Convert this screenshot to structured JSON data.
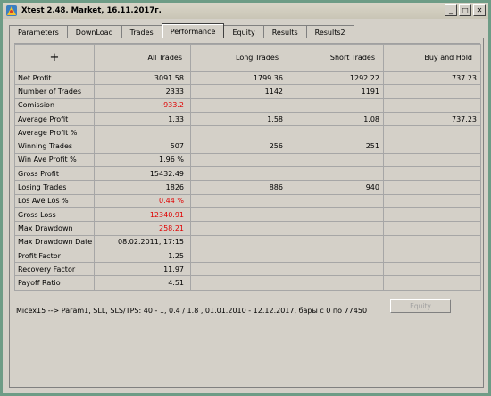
{
  "window": {
    "title": "Xtest 2.48. Market, 16.11.2017г.",
    "buttons": {
      "minimize": "_",
      "maximize": "□",
      "close": "✕"
    }
  },
  "tabs": [
    "Parameters",
    "DownLoad",
    "Trades",
    "Performance",
    "Equity",
    "Results",
    "Results2"
  ],
  "active_tab": "Performance",
  "table": {
    "corner": "+",
    "columns": [
      "All Trades",
      "Long Trades",
      "Short Trades",
      "Buy and Hold"
    ],
    "rows": [
      {
        "label": "Net Profit",
        "cells": [
          "3091.58",
          "1799.36",
          "1292.22",
          "737.23"
        ],
        "red": false
      },
      {
        "label": "Number of Trades",
        "cells": [
          "2333",
          "1142",
          "1191",
          ""
        ],
        "red": false
      },
      {
        "label": "Comission",
        "cells": [
          "-933.2",
          "",
          "",
          ""
        ],
        "red": true
      },
      {
        "label": "Average Profit",
        "cells": [
          "1.33",
          "1.58",
          "1.08",
          "737.23"
        ],
        "red": false
      },
      {
        "label": "Average Profit %",
        "cells": [
          "",
          "",
          "",
          ""
        ],
        "red": false
      },
      {
        "label": "Winning Trades",
        "cells": [
          "507",
          "256",
          "251",
          ""
        ],
        "red": false
      },
      {
        "label": "Win Ave Profit %",
        "cells": [
          "1.96 %",
          "",
          "",
          ""
        ],
        "red": false
      },
      {
        "label": "Gross Profit",
        "cells": [
          "15432.49",
          "",
          "",
          ""
        ],
        "red": false
      },
      {
        "label": "Losing Trades",
        "cells": [
          "1826",
          "886",
          "940",
          ""
        ],
        "red": false
      },
      {
        "label": "Los Ave Los %",
        "cells": [
          "0.44 %",
          "",
          "",
          ""
        ],
        "red": true
      },
      {
        "label": "Gross Loss",
        "cells": [
          "12340.91",
          "",
          "",
          ""
        ],
        "red": true
      },
      {
        "label": "Max Drawdown",
        "cells": [
          "258.21",
          "",
          "",
          ""
        ],
        "red": true
      },
      {
        "label": "Max Drawdown Date",
        "cells": [
          "08.02.2011, 17:15",
          "",
          "",
          ""
        ],
        "red": false
      },
      {
        "label": "Profit Factor",
        "cells": [
          "1.25",
          "",
          "",
          ""
        ],
        "red": false
      },
      {
        "label": "Recovery Factor",
        "cells": [
          "11.97",
          "",
          "",
          ""
        ],
        "red": false
      },
      {
        "label": "Payoff Ratio",
        "cells": [
          "4.51",
          "",
          "",
          ""
        ],
        "red": false
      }
    ]
  },
  "status_line": "Micex15  -->  Param1, SLL, SLS/TPS:  40 - 1, 0.4 / 1.8 , 01.01.2010 - 12.12.2017, бары с 0 по 77450",
  "equity_button": "Equity",
  "colors": {
    "negative": "#e00000",
    "panel": "#d4d0c8"
  }
}
